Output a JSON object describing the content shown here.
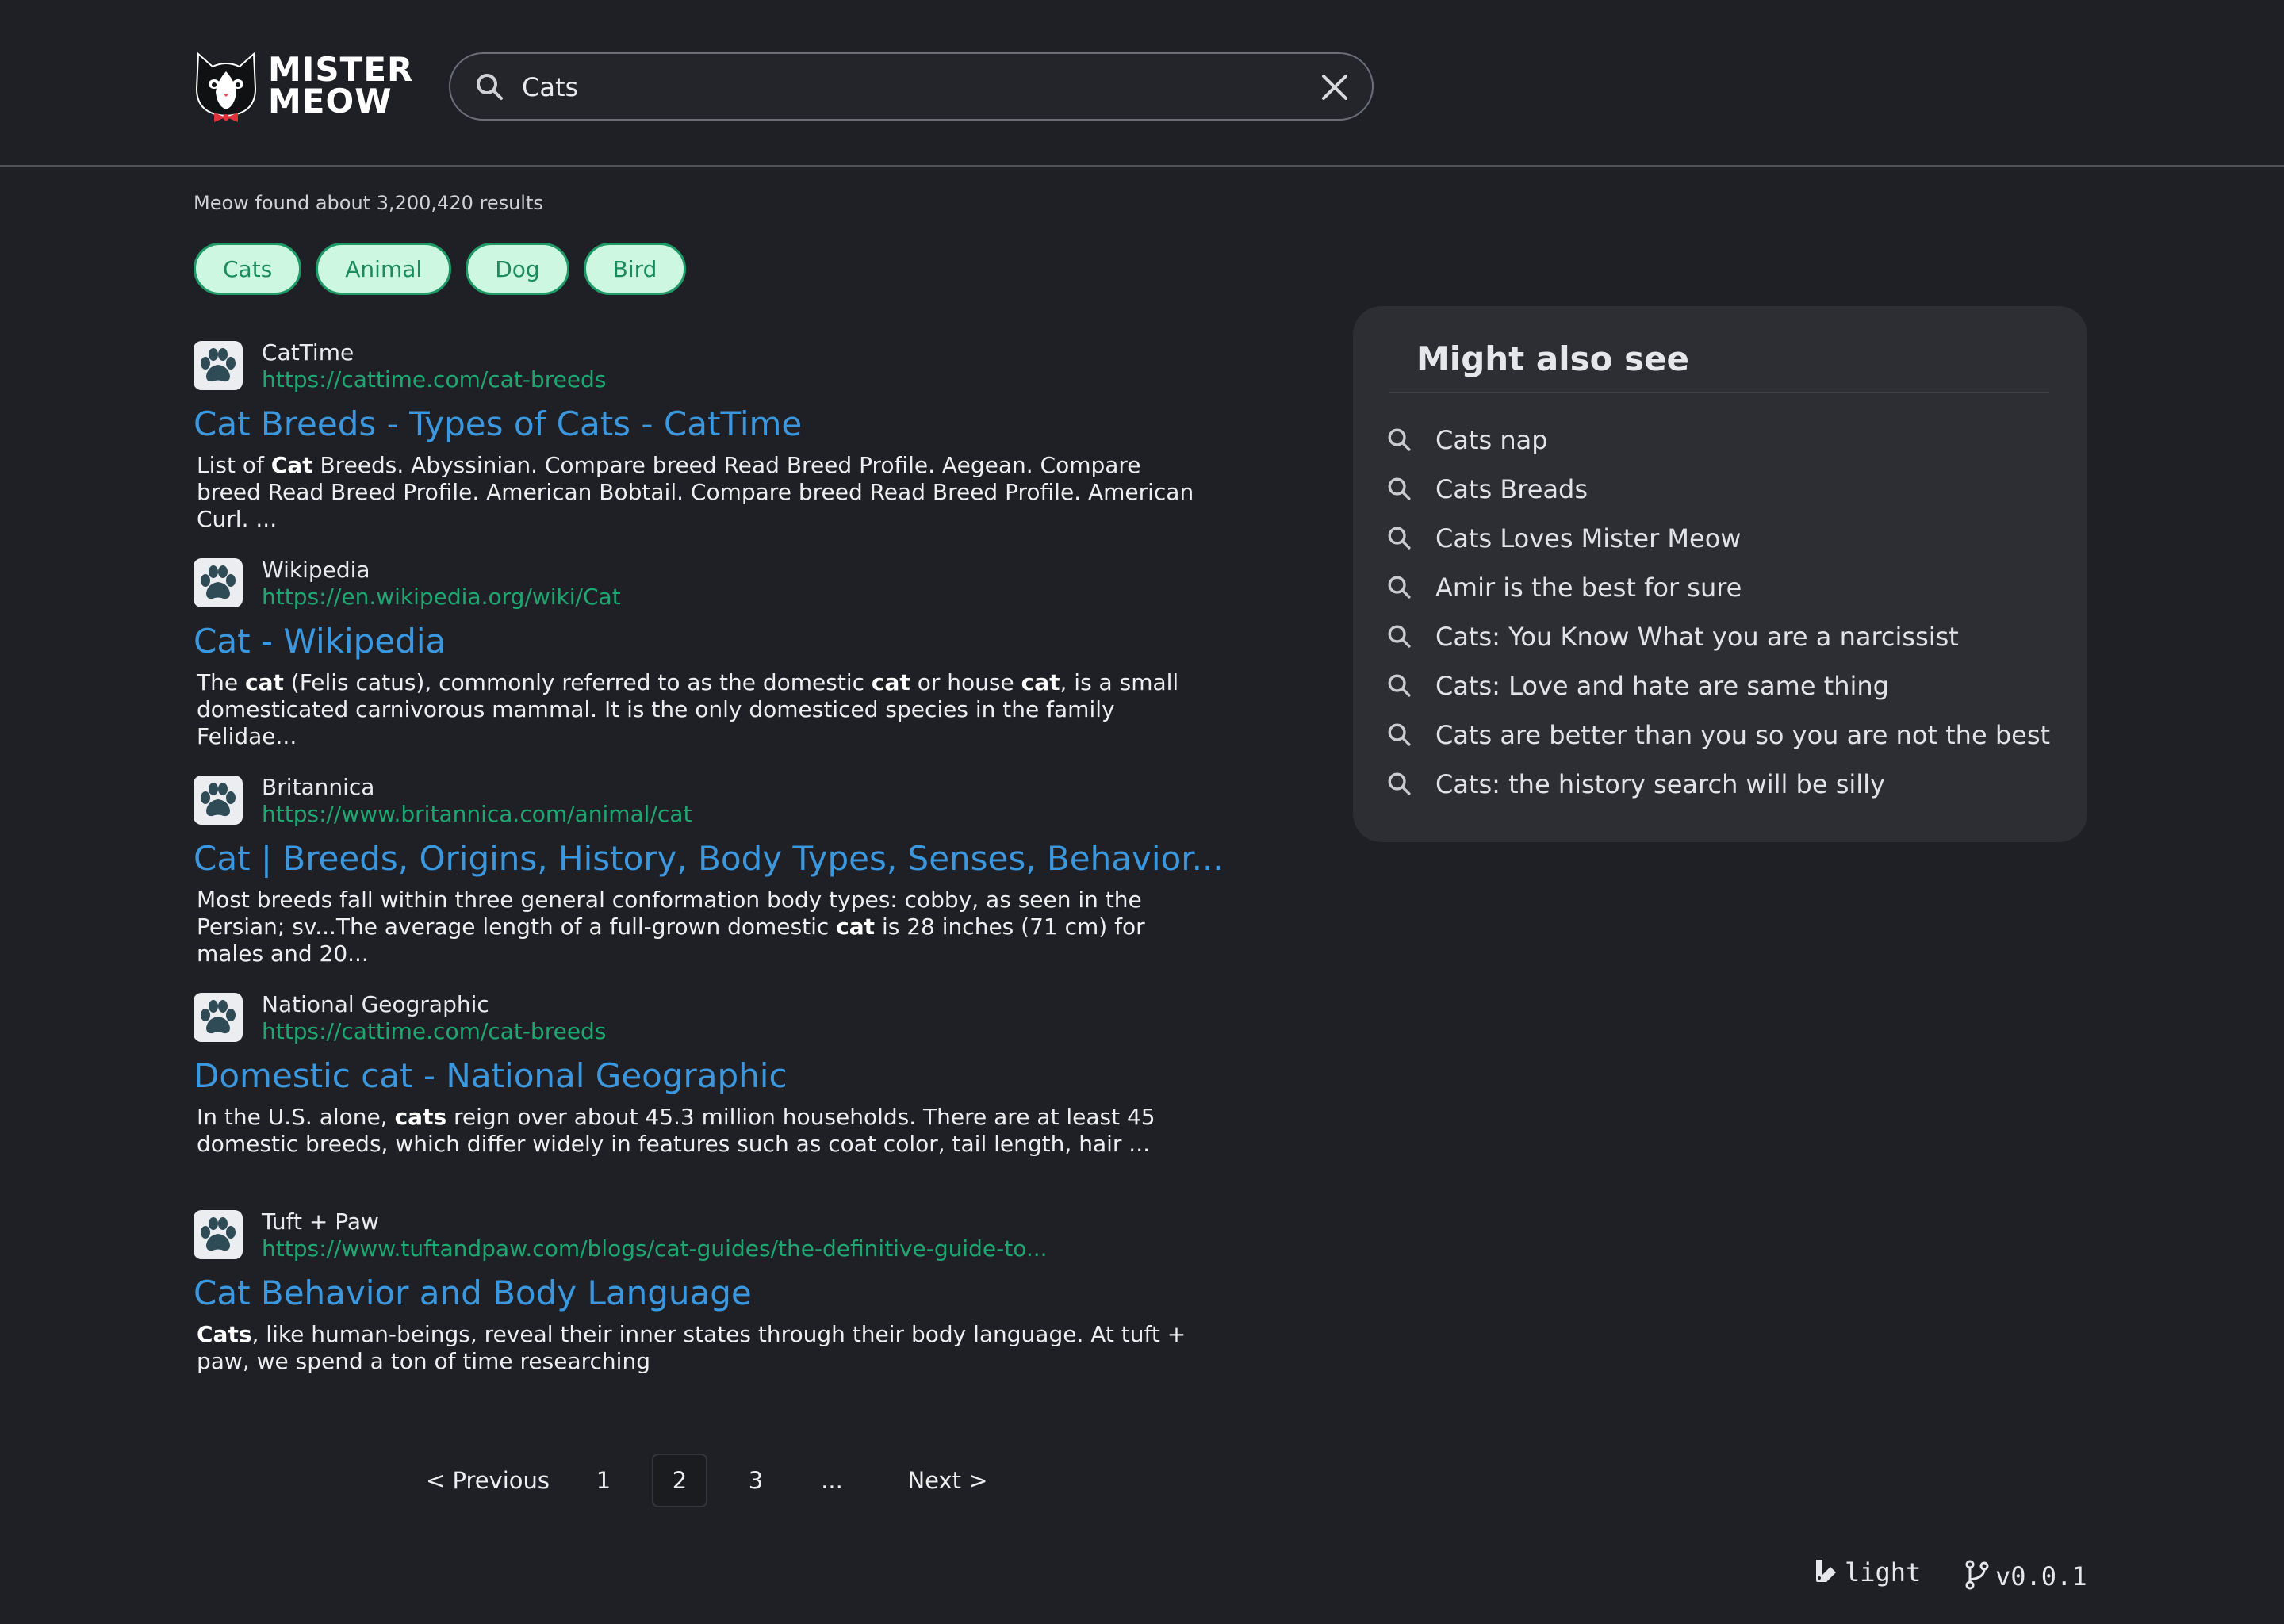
{
  "brand": {
    "name_line1": "MISTER",
    "name_line2": "MEOW",
    "logo_icon": "cat-face-icon"
  },
  "search": {
    "value": "Cats",
    "placeholder": "",
    "search_icon": "search-icon",
    "clear_icon": "close-icon"
  },
  "result_count": "Meow found about 3,200,420 results",
  "chips": [
    "Cats",
    "Animal",
    "Dog",
    "Bird"
  ],
  "results": [
    {
      "site": "CatTime",
      "url": "https://cattime.com/cat-breeds",
      "title": "Cat Breeds - Types of Cats - CatTime",
      "snippet": "List of <b>Cat</b> Breeds. Abyssinian. Compare breed Read Breed Profile. Aegean. Compare breed Read Breed Profile. American Bobtail. Compare breed Read Breed Profile. American Curl. ..."
    },
    {
      "site": "Wikipedia",
      "url": "https://en.wikipedia.org/wiki/Cat",
      "title": "Cat - Wikipedia",
      "snippet": "The <b>cat</b> (Felis catus), commonly referred to as the domestic <b>cat</b> or house <b>cat</b>, is a small domesticated carnivorous mammal. It is the only domesticed species in the family Felidae..."
    },
    {
      "site": "Britannica",
      "url": "https://www.britannica.com/animal/cat",
      "title": "Cat | Breeds, Origins, History, Body Types, Senses, Behavior...",
      "snippet": "Most breeds fall within three general conformation body types: cobby, as seen in the Persian; sv...The average length of a full-grown domestic <b>cat</b> is 28 inches (71 cm) for males and 20..."
    },
    {
      "site": "National Geographic",
      "url": "https://cattime.com/cat-breeds",
      "title": "Domestic cat - National Geographic",
      "snippet": "In the U.S. alone, <b>cats</b> reign over about 45.3 million households. There are at least 45 domestic breeds, which differ widely in features such as coat color, tail length, hair ..."
    },
    {
      "site": "Tuft + Paw",
      "url": "https://www.tuftandpaw.com/blogs/cat-guides/the-definitive-guide-to...",
      "title": "Cat Behavior and Body Language",
      "snippet": "<b>Cats</b>, like human-beings, reveal their inner states through their body language. At tuft + paw, we spend a ton of time researching"
    }
  ],
  "pagination": {
    "previous": "< Previous",
    "pages": [
      "1",
      "2",
      "3"
    ],
    "current": "2",
    "ellipsis": "...",
    "next": "Next >"
  },
  "aside": {
    "title": "Might also see",
    "suggestions": [
      "Cats nap",
      "Cats Breads",
      "Cats Loves Mister Meow",
      "Amir is the best for sure",
      "Cats: You Know What you are a narcissist",
      "Cats: Love and hate are same thing",
      "Cats are better than you so you are not the best",
      "Cats: the history search will be silly"
    ]
  },
  "footer": {
    "theme_label": "light",
    "version": "v0.0.1"
  },
  "colors": {
    "background": "#1f2025",
    "link": "#3b98df",
    "url": "#1fa772",
    "chip_bg": "#cdf7e1",
    "chip_border": "#1e9a66"
  }
}
